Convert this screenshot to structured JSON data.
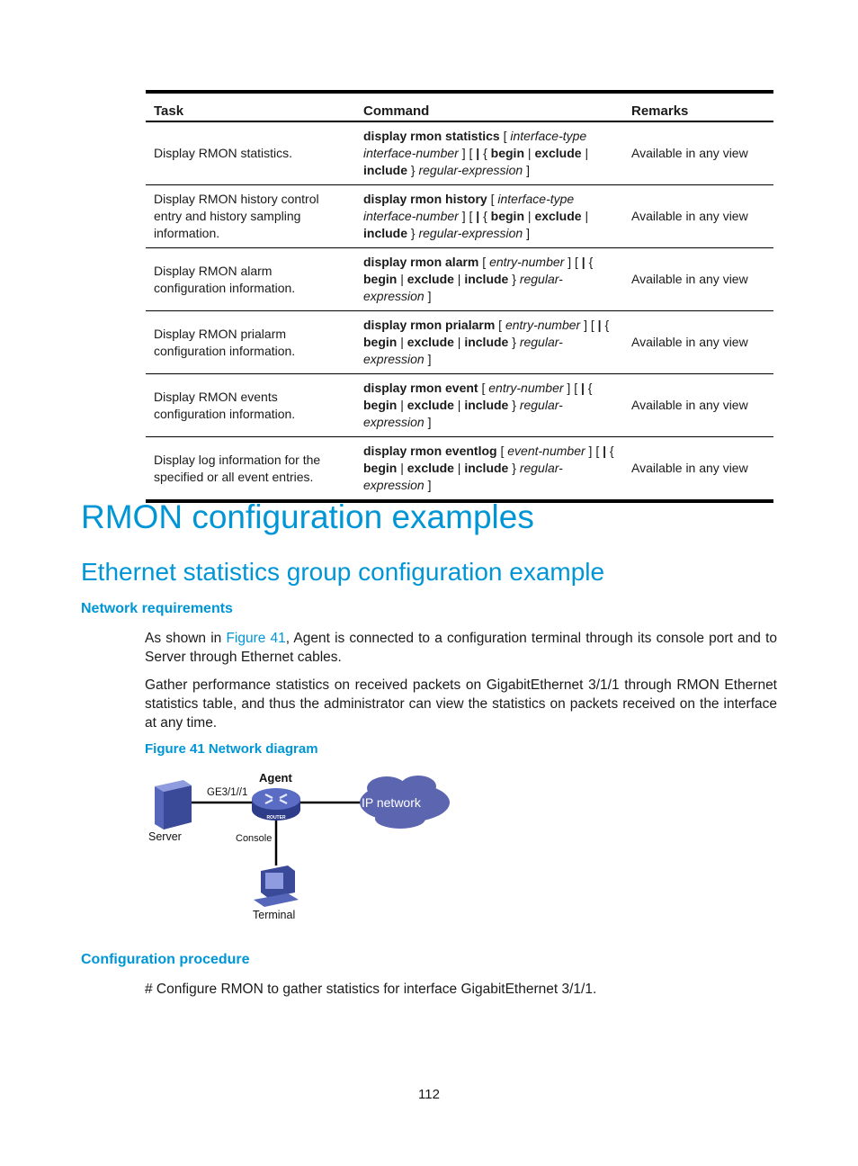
{
  "table": {
    "headers": {
      "task": "Task",
      "command": "Command",
      "remarks": "Remarks"
    },
    "rows": [
      {
        "task": "Display RMON statistics.",
        "command": [
          {
            "t": "display rmon statistics",
            "s": "b"
          },
          {
            "t": " [ ",
            "s": ""
          },
          {
            "t": "interface-type",
            "s": "i"
          },
          {
            "t": " ",
            "s": ""
          },
          {
            "t": "interface-number",
            "s": "i"
          },
          {
            "t": " ] [ ",
            "s": ""
          },
          {
            "t": "|",
            "s": "b"
          },
          {
            "t": " { ",
            "s": ""
          },
          {
            "t": "begin",
            "s": "b"
          },
          {
            "t": " | ",
            "s": ""
          },
          {
            "t": "exclude",
            "s": "b"
          },
          {
            "t": " | ",
            "s": ""
          },
          {
            "t": "include",
            "s": "b"
          },
          {
            "t": " } ",
            "s": ""
          },
          {
            "t": "regular-expression",
            "s": "i"
          },
          {
            "t": " ]",
            "s": ""
          }
        ],
        "remarks": "Available in any view"
      },
      {
        "task": "Display RMON history control entry and history sampling information.",
        "command": [
          {
            "t": "display rmon history",
            "s": "b"
          },
          {
            "t": " [ ",
            "s": ""
          },
          {
            "t": "interface-type",
            "s": "i"
          },
          {
            "t": " ",
            "s": ""
          },
          {
            "t": "interface-number",
            "s": "i"
          },
          {
            "t": " ] [ ",
            "s": ""
          },
          {
            "t": "|",
            "s": "b"
          },
          {
            "t": " { ",
            "s": ""
          },
          {
            "t": "begin",
            "s": "b"
          },
          {
            "t": " | ",
            "s": ""
          },
          {
            "t": "exclude",
            "s": "b"
          },
          {
            "t": " | ",
            "s": ""
          },
          {
            "t": "include",
            "s": "b"
          },
          {
            "t": " } ",
            "s": ""
          },
          {
            "t": "regular-expression",
            "s": "i"
          },
          {
            "t": " ]",
            "s": ""
          }
        ],
        "remarks": "Available in any view"
      },
      {
        "task": "Display RMON alarm configuration information.",
        "command": [
          {
            "t": "display rmon alarm",
            "s": "b"
          },
          {
            "t": " [ ",
            "s": ""
          },
          {
            "t": "entry-number",
            "s": "i"
          },
          {
            "t": " ] [ ",
            "s": ""
          },
          {
            "t": "|",
            "s": "b"
          },
          {
            "t": " { ",
            "s": ""
          },
          {
            "t": "begin",
            "s": "b"
          },
          {
            "t": " | ",
            "s": ""
          },
          {
            "t": "exclude",
            "s": "b"
          },
          {
            "t": " | ",
            "s": ""
          },
          {
            "t": "include",
            "s": "b"
          },
          {
            "t": " } ",
            "s": ""
          },
          {
            "t": "regular-expression",
            "s": "i"
          },
          {
            "t": " ]",
            "s": ""
          }
        ],
        "remarks": "Available in any view"
      },
      {
        "task": "Display RMON prialarm configuration information.",
        "command": [
          {
            "t": "display rmon prialarm",
            "s": "b"
          },
          {
            "t": " [ ",
            "s": ""
          },
          {
            "t": "entry-number",
            "s": "i"
          },
          {
            "t": " ] [ ",
            "s": ""
          },
          {
            "t": "|",
            "s": "b"
          },
          {
            "t": " { ",
            "s": ""
          },
          {
            "t": "begin",
            "s": "b"
          },
          {
            "t": " | ",
            "s": ""
          },
          {
            "t": "exclude",
            "s": "b"
          },
          {
            "t": " | ",
            "s": ""
          },
          {
            "t": "include",
            "s": "b"
          },
          {
            "t": " } ",
            "s": ""
          },
          {
            "t": "regular-expression",
            "s": "i"
          },
          {
            "t": " ]",
            "s": ""
          }
        ],
        "remarks": "Available in any view"
      },
      {
        "task": "Display RMON events configuration information.",
        "command": [
          {
            "t": "display rmon event",
            "s": "b"
          },
          {
            "t": " [ ",
            "s": ""
          },
          {
            "t": "entry-number",
            "s": "i"
          },
          {
            "t": " ] [ ",
            "s": ""
          },
          {
            "t": "|",
            "s": "b"
          },
          {
            "t": " { ",
            "s": ""
          },
          {
            "t": "begin",
            "s": "b"
          },
          {
            "t": " | ",
            "s": ""
          },
          {
            "t": "exclude",
            "s": "b"
          },
          {
            "t": " | ",
            "s": ""
          },
          {
            "t": "include",
            "s": "b"
          },
          {
            "t": " } ",
            "s": ""
          },
          {
            "t": "regular-expression",
            "s": "i"
          },
          {
            "t": " ]",
            "s": ""
          }
        ],
        "remarks": "Available in any view"
      },
      {
        "task": "Display log information for the specified or all event entries.",
        "command": [
          {
            "t": "display rmon eventlog",
            "s": "b"
          },
          {
            "t": " [ ",
            "s": ""
          },
          {
            "t": "event-number",
            "s": "i"
          },
          {
            "t": " ] [ ",
            "s": ""
          },
          {
            "t": "|",
            "s": "b"
          },
          {
            "t": " { ",
            "s": ""
          },
          {
            "t": "begin",
            "s": "b"
          },
          {
            "t": " | ",
            "s": ""
          },
          {
            "t": "exclude",
            "s": "b"
          },
          {
            "t": " | ",
            "s": ""
          },
          {
            "t": "include",
            "s": "b"
          },
          {
            "t": " } ",
            "s": ""
          },
          {
            "t": "regular-expression",
            "s": "i"
          },
          {
            "t": " ]",
            "s": ""
          }
        ],
        "remarks": "Available in any view"
      }
    ]
  },
  "headings": {
    "h1": "RMON configuration examples",
    "h2": "Ethernet statistics group configuration example",
    "network_requirements": "Network requirements",
    "configuration_procedure": "Configuration procedure"
  },
  "paragraphs": {
    "p1_before_link": "As shown in ",
    "p1_link": "Figure 41",
    "p1_after_link": ", Agent is connected to a configuration terminal through its console port and to Server through Ethernet cables.",
    "p2": "Gather performance statistics on received packets on GigabitEthernet 3/1/1 through RMON Ethernet statistics table, and thus the administrator can view the statistics on packets received on the interface at any time.",
    "p3": "# Configure RMON to gather statistics for interface GigabitEthernet 3/1/1."
  },
  "figure": {
    "caption": "Figure 41 Network diagram",
    "labels": {
      "agent": "Agent",
      "interface": "GE3/1//1",
      "server": "Server",
      "console": "Console",
      "terminal": "Terminal",
      "cloud": "IP network",
      "router_badge": "ROUTER"
    },
    "colors": {
      "device": "#4a5ba8",
      "device_light": "#7d8fd0",
      "cloud": "#5b65b0",
      "link": "#000000"
    }
  },
  "page_number": "112",
  "colors": {
    "accent": "#0096d6"
  }
}
